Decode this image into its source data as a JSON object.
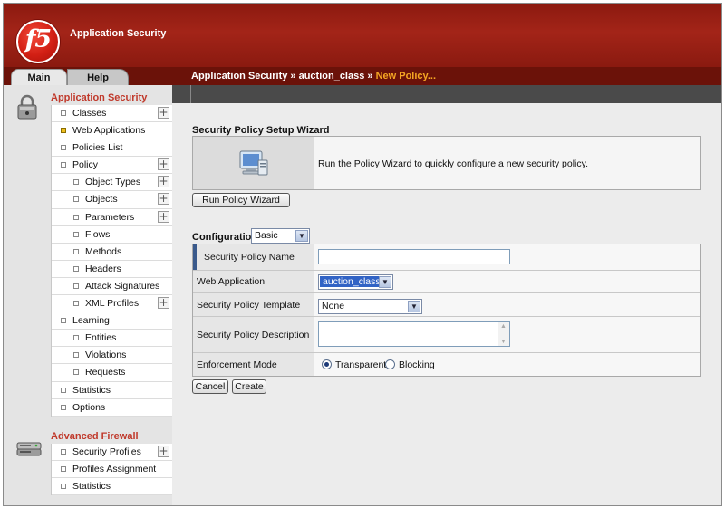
{
  "header": {
    "logo_text": "f5",
    "app_title": "Application Security"
  },
  "tabs": [
    {
      "label": "Main"
    },
    {
      "label": "Help"
    }
  ],
  "breadcrumb": {
    "path": "Application Security » auction_class » ",
    "current": "New Policy..."
  },
  "sidebar": {
    "app_security": {
      "title": "Application Security",
      "icon": "padlock-icon",
      "items": [
        {
          "label": "Classes",
          "level": 1,
          "expandable": true
        },
        {
          "label": "Web Applications",
          "level": 1,
          "active": true
        },
        {
          "label": "Policies List",
          "level": 1
        },
        {
          "label": "Policy",
          "level": 1,
          "expandable": true
        },
        {
          "label": "Object Types",
          "level": 2,
          "expandable": true
        },
        {
          "label": "Objects",
          "level": 2,
          "expandable": true
        },
        {
          "label": "Parameters",
          "level": 2,
          "expandable": true
        },
        {
          "label": "Flows",
          "level": 2
        },
        {
          "label": "Methods",
          "level": 2
        },
        {
          "label": "Headers",
          "level": 2
        },
        {
          "label": "Attack Signatures",
          "level": 2
        },
        {
          "label": "XML Profiles",
          "level": 2,
          "expandable": true
        },
        {
          "label": "Learning",
          "level": 1
        },
        {
          "label": "Entities",
          "level": 2
        },
        {
          "label": "Violations",
          "level": 2
        },
        {
          "label": "Requests",
          "level": 2
        },
        {
          "label": "Statistics",
          "level": 1
        },
        {
          "label": "Options",
          "level": 1
        }
      ]
    },
    "advanced_firewall": {
      "title": "Advanced Firewall",
      "icon": "firewall-device-icon",
      "items": [
        {
          "label": "Security Profiles",
          "level": 1,
          "expandable": true
        },
        {
          "label": "Profiles Assignment",
          "level": 1
        },
        {
          "label": "Statistics",
          "level": 1
        }
      ]
    }
  },
  "wizard": {
    "heading": "Security Policy Setup Wizard",
    "description": "Run the Policy Wizard to quickly configure a new security policy.",
    "icon": "monitor-icon",
    "button_label": "Run Policy Wizard"
  },
  "configuration": {
    "heading": "Configuration",
    "mode_value": "Basic",
    "fields": {
      "name_label": "Security Policy Name",
      "name_value": "",
      "webapp_label": "Web Application",
      "webapp_value": "auction_class",
      "template_label": "Security Policy Template",
      "template_value": "None",
      "description_label": "Security Policy Description",
      "description_value": "",
      "enforcement_label": "Enforcement Mode",
      "enforcement_options": [
        "Transparent",
        "Blocking"
      ],
      "enforcement_selected": "Transparent"
    }
  },
  "actions": {
    "cancel_label": "Cancel",
    "create_label": "Create"
  },
  "colors": {
    "header_red": "#a32418",
    "section_title": "#c0392b",
    "breadcrumb_current": "#f5a623",
    "selection_blue": "#3163c5"
  }
}
